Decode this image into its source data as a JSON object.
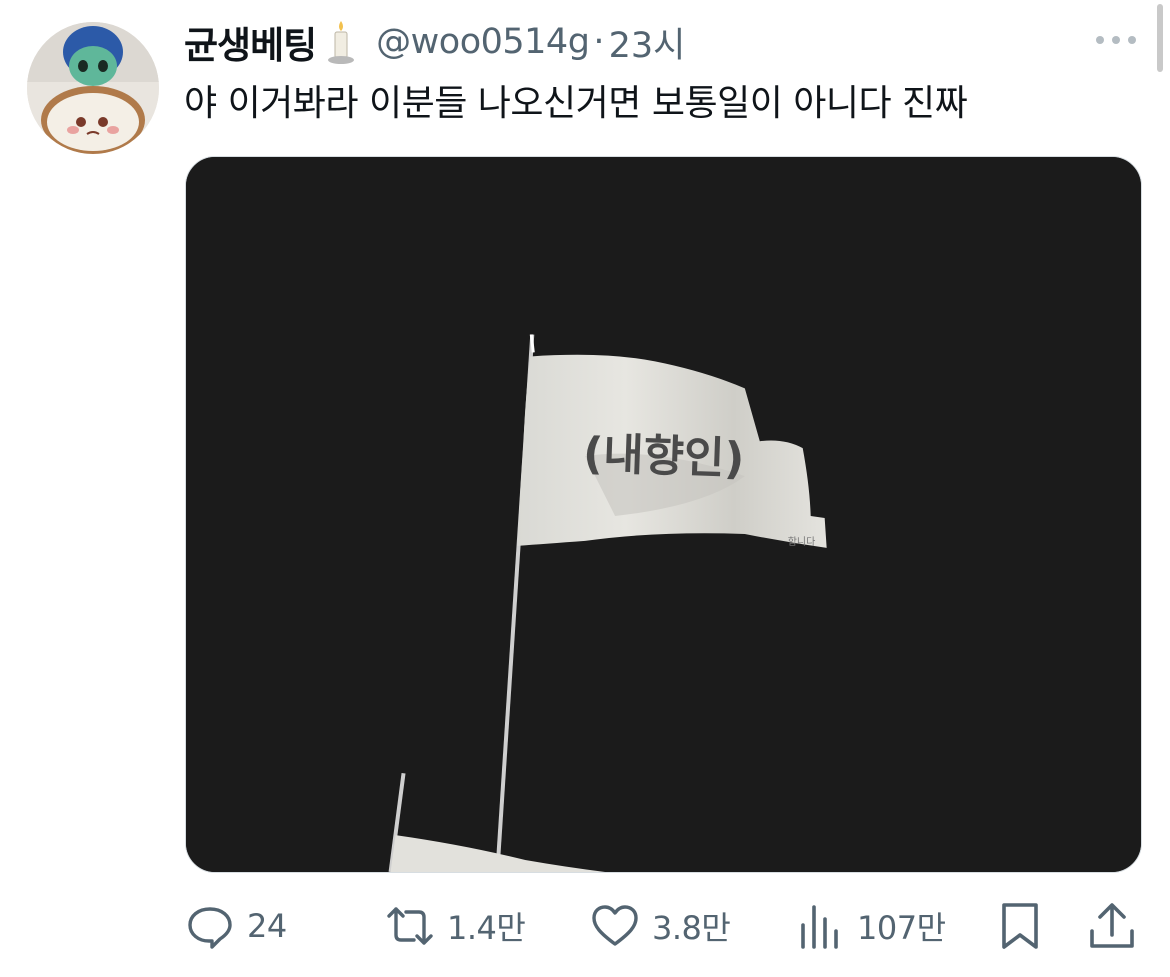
{
  "tweet": {
    "display_name": "균생베팅",
    "handle": "@woo0514g",
    "separator": "·",
    "time": "23시",
    "text": "야 이거봐라 이분들 나오신거면 보통일이 아니다 진짜",
    "name_emoji_icon": "candle-icon"
  },
  "media": {
    "flag_text": "(내향인)",
    "flag_small_text": "합니다"
  },
  "actions": {
    "reply": {
      "icon": "reply-icon",
      "count": "24"
    },
    "retweet": {
      "icon": "retweet-icon",
      "count": "1.4만"
    },
    "like": {
      "icon": "heart-icon",
      "count": "3.8만"
    },
    "views": {
      "icon": "views-icon",
      "count": "107만"
    },
    "bookmark": {
      "icon": "bookmark-icon"
    },
    "share": {
      "icon": "share-icon"
    }
  },
  "colors": {
    "text": "#0f1419",
    "secondary": "#536471",
    "media_bg": "#1b1b1b"
  }
}
